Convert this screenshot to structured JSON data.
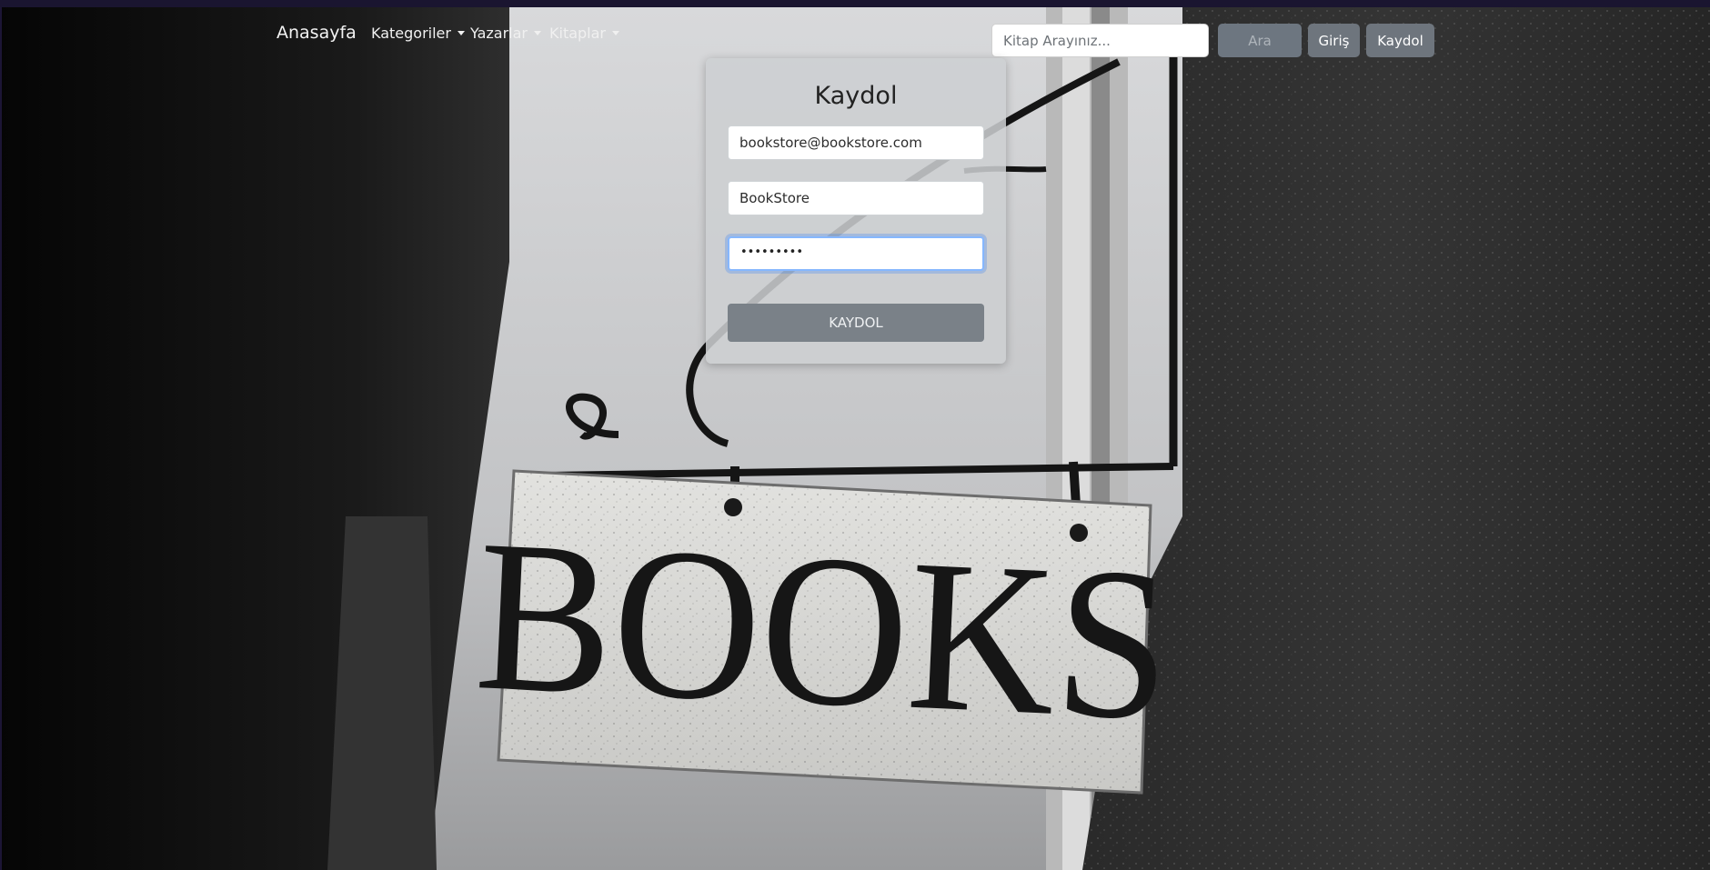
{
  "navbar": {
    "brand": "Anasayfa",
    "menu": [
      {
        "label": "Kategoriler"
      },
      {
        "label": "Yazarlar"
      },
      {
        "label": "Kitaplar"
      }
    ],
    "search_placeholder": "Kitap Arayınız...",
    "search_button": "Ara",
    "login_button": "Giriş",
    "register_button": "Kaydol"
  },
  "register_form": {
    "title": "Kaydol",
    "email_value": "bookstore@bookstore.com",
    "username_value": "BookStore",
    "password_masked": "•••••••••",
    "submit_label": "KAYDOL"
  },
  "background": {
    "sign_text": "BOOKS"
  }
}
